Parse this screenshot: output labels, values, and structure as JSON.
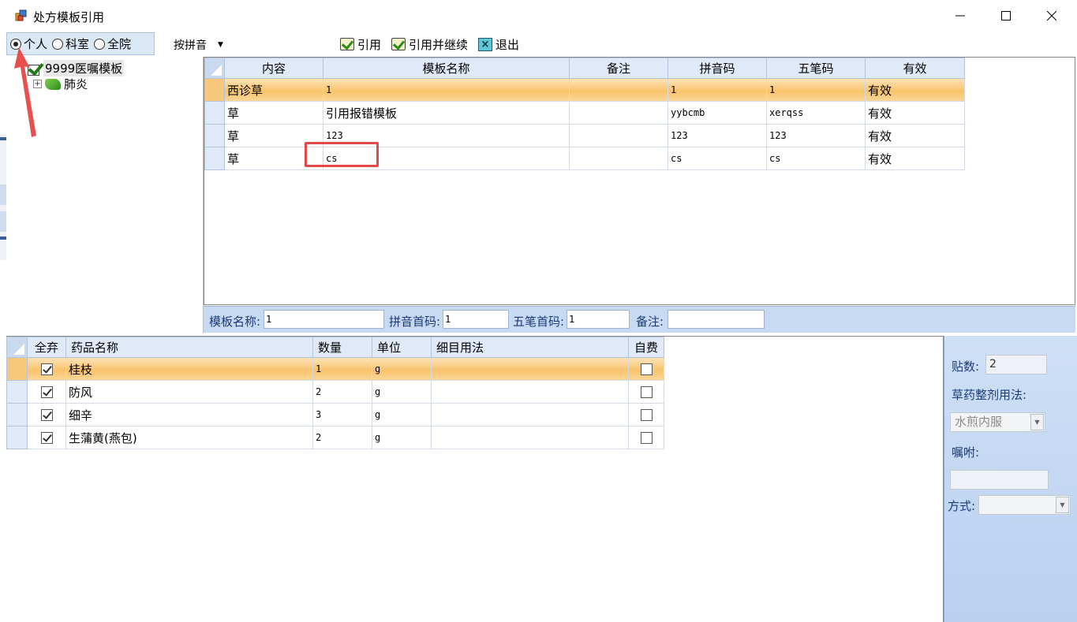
{
  "window": {
    "title": "处方模板引用"
  },
  "toolbar": {
    "scope_options": [
      "个人",
      "科室",
      "全院"
    ],
    "scope_selected": "个人",
    "sort_label": "按拼音",
    "reference_label": "引用",
    "reference_continue_label": "引用并继续",
    "exit_label": "退出"
  },
  "tree": {
    "root_label": "9999医嘱模板",
    "child_label": "肺炎"
  },
  "template_grid": {
    "headers": [
      "内容",
      "模板名称",
      "备注",
      "拼音码",
      "五笔码",
      "有效"
    ],
    "rows": [
      {
        "content": "西诊草",
        "name": "1",
        "note": "",
        "pinyin": "1",
        "wubi": "1",
        "valid": "有效"
      },
      {
        "content": "草",
        "name": "引用报错模板",
        "note": "",
        "pinyin": "yybcmb",
        "wubi": "xerqss",
        "valid": "有效"
      },
      {
        "content": "草",
        "name": "123",
        "note": "",
        "pinyin": "123",
        "wubi": "123",
        "valid": "有效"
      },
      {
        "content": "草",
        "name": "cs",
        "note": "",
        "pinyin": "cs",
        "wubi": "cs",
        "valid": "有效"
      }
    ],
    "selected_row": 0
  },
  "template_form": {
    "name_label": "模板名称:",
    "name_value": "1",
    "pinyin_label": "拼音首码:",
    "pinyin_value": "1",
    "wubi_label": "五笔首码:",
    "wubi_value": "1",
    "note_label": "备注:",
    "note_value": ""
  },
  "drug_grid": {
    "headers": [
      "全弃",
      "药品名称",
      "数量",
      "单位",
      "细目用法",
      "自费"
    ],
    "rows": [
      {
        "checked": true,
        "name": "桂枝",
        "qty": "1",
        "unit": "g",
        "usage": "",
        "self_pay": false
      },
      {
        "checked": true,
        "name": "防风",
        "qty": "2",
        "unit": "g",
        "usage": "",
        "self_pay": false
      },
      {
        "checked": true,
        "name": "细辛",
        "qty": "3",
        "unit": "g",
        "usage": "",
        "self_pay": false
      },
      {
        "checked": true,
        "name": "生蒲黄(燕包)",
        "qty": "2",
        "unit": "g",
        "usage": "",
        "self_pay": false
      }
    ],
    "selected_row": 0
  },
  "side_panel": {
    "doses_label": "贴数:",
    "doses_value": "2",
    "usage_label": "草药整剂用法:",
    "usage_value": "水煎内服",
    "instruction_label": "嘱咐:",
    "instruction_value": "",
    "method_label": "方式:",
    "method_value": ""
  },
  "colors": {
    "selected_row": "#f9c36b",
    "header_bg": "#dfe9f7",
    "highlight": "#e24a4a",
    "arrow": "#e8504f"
  }
}
